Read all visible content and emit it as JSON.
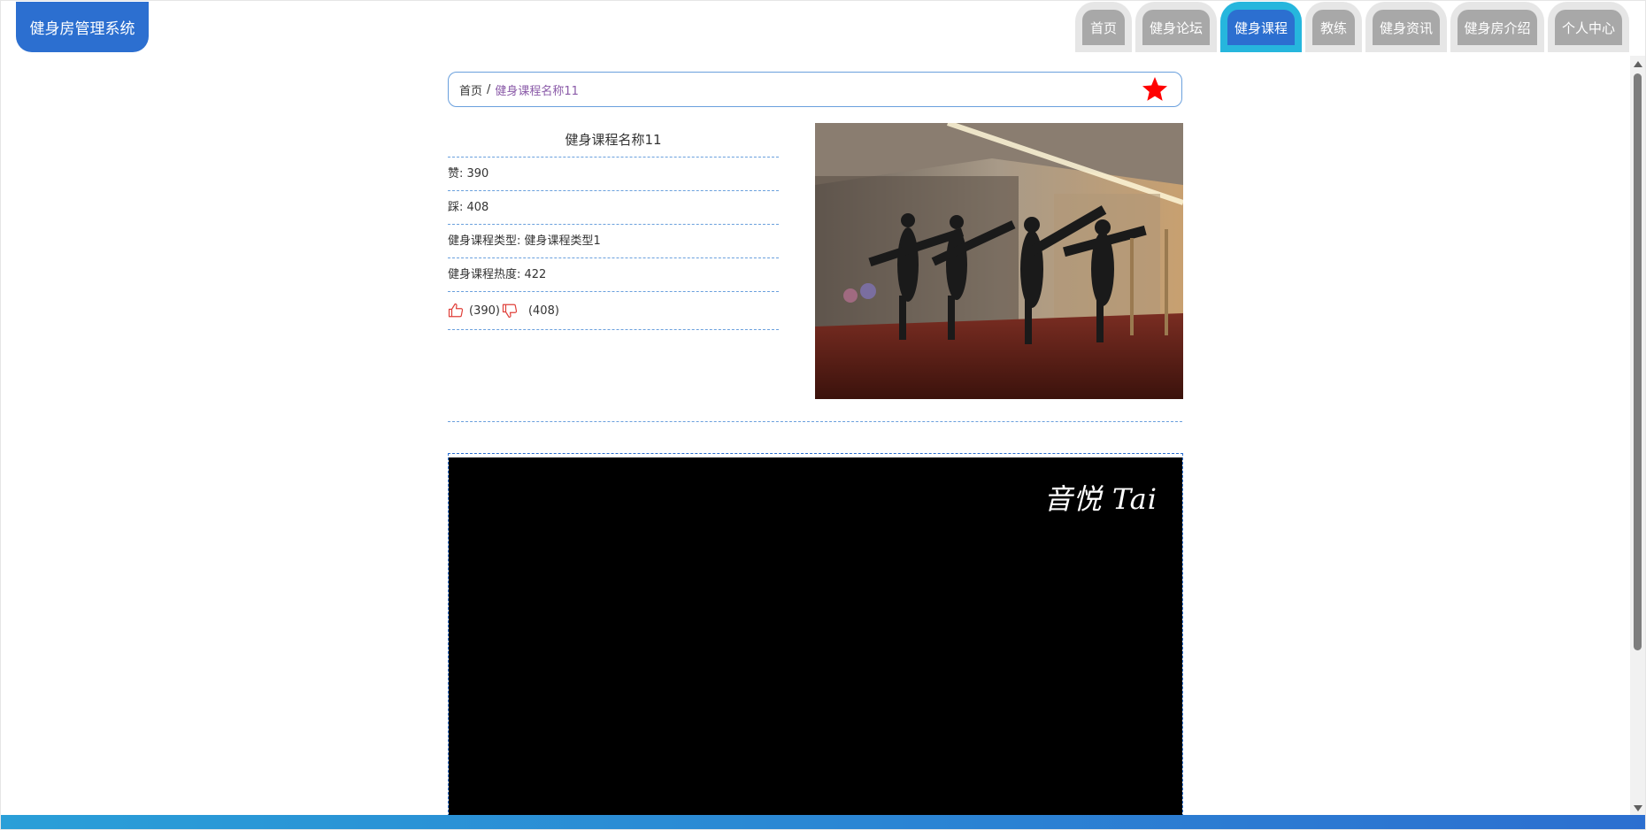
{
  "app": {
    "title": "健身房管理系统"
  },
  "nav": {
    "items": [
      {
        "label": "首页",
        "active": false
      },
      {
        "label": "健身论坛",
        "active": false
      },
      {
        "label": "健身课程",
        "active": true
      },
      {
        "label": "教练",
        "active": false
      },
      {
        "label": "健身资讯",
        "active": false
      },
      {
        "label": "健身房介绍",
        "active": false
      },
      {
        "label": "个人中心",
        "active": false
      }
    ]
  },
  "breadcrumb": {
    "home": "首页",
    "separator": "/",
    "current": "健身课程名称11"
  },
  "course": {
    "name": "健身课程名称11",
    "likes_row": "赞: 390",
    "dislikes_row": "踩: 408",
    "type_row": "健身课程类型: 健身课程类型1",
    "heat_row": "健身课程热度: 422",
    "like_count": "(390)",
    "dislike_count": "(408)"
  },
  "video": {
    "watermark": "音悦 Tai"
  },
  "colors": {
    "brand": "#2c6fd0",
    "active_tab_outer": "#26b6dd",
    "tab_inner": "#a8a8a8",
    "tab_outer": "#e6e6e6",
    "favorite_star": "#ff0000",
    "vote_icon": "#e0403a"
  },
  "icons": {
    "favorite": "star-icon",
    "like": "thumbs-up-icon",
    "dislike": "thumbs-down-icon"
  }
}
